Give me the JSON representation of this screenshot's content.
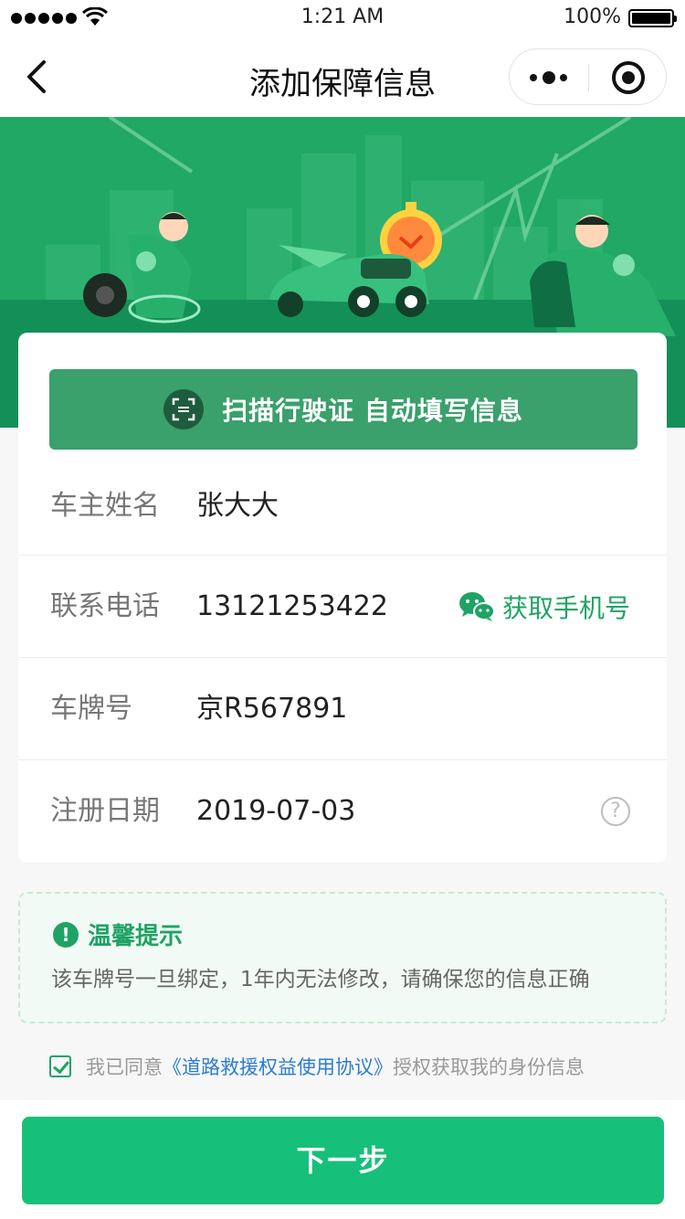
{
  "status_bar": {
    "time": "1:21 AM",
    "battery": "100%"
  },
  "nav": {
    "title": "添加保障信息"
  },
  "scan": {
    "label": "扫描行驶证 自动填写信息"
  },
  "form": {
    "rows": [
      {
        "label": "车主姓名",
        "value": "张大大"
      },
      {
        "label": "联系电话",
        "value": "13121253422",
        "action": "获取手机号"
      },
      {
        "label": "车牌号",
        "value": "京R567891"
      },
      {
        "label": "注册日期",
        "value": "2019-07-03",
        "help": "?"
      }
    ]
  },
  "tip": {
    "title": "温馨提示",
    "icon": "!",
    "text": "该车牌号一旦绑定，1年内无法修改，请确保您的信息正确"
  },
  "agreement": {
    "checked": true,
    "prefix": "我已同意",
    "link": "《道路救援权益使用协议》",
    "suffix": "授权获取我的身份信息"
  },
  "footer": {
    "next_label": "下一步"
  },
  "colors": {
    "brand_green": "#1fa365",
    "button_green": "#17c07a",
    "link_blue": "#2b7cd3"
  }
}
